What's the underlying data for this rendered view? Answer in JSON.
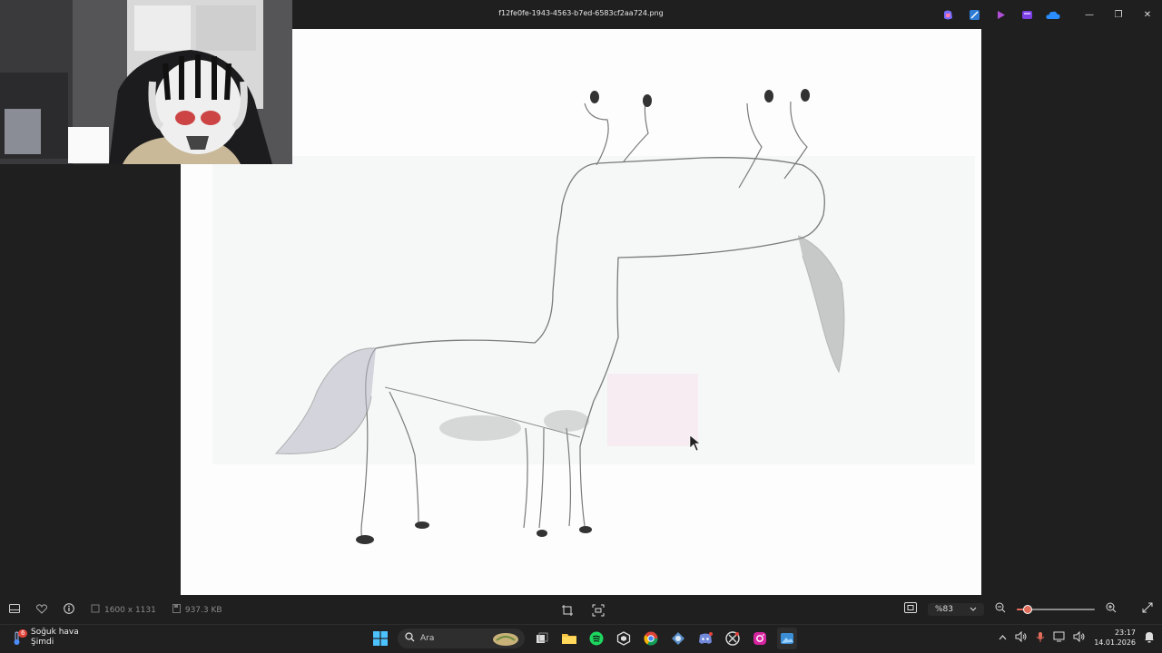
{
  "window": {
    "title": "f12fe0fe-1943-4563-b7ed-6583cf2aa724.png",
    "minimize_glyph": "—",
    "maximize_glyph": "❐",
    "close_glyph": "✕"
  },
  "toolbar_icons": [
    "copilot-icon",
    "image-creator-icon",
    "clipchamp-icon",
    "designer-icon",
    "onedrive-icon"
  ],
  "image_info": {
    "dimensions": "1600 x 1131",
    "file_size": "937.3 KB"
  },
  "zoom": {
    "value": "%83",
    "fraction": 0.14
  },
  "taskbar": {
    "weather_title": "Soğuk hava",
    "weather_subtitle": "Şimdi",
    "weather_badge": "6",
    "search_placeholder": "Ara",
    "time": "23:17",
    "date": "14.01.2026"
  },
  "colors": {
    "accent": "#e36d5b",
    "chrome_bg": "#1f1f1f",
    "taskbar_bg": "#202020"
  }
}
